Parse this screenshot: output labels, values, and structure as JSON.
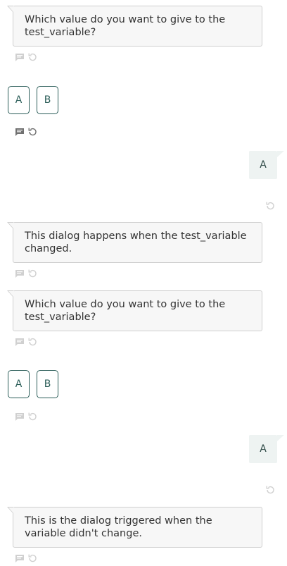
{
  "messages": {
    "q1": "Which value do you want to give to the test_variable?",
    "m2": "This dialog happens when the test_variable changed.",
    "q2": "Which value do you want to give to the test_variable?",
    "m3": "This is the dialog triggered when the variable didn't change."
  },
  "choices_1": [
    "A",
    "B"
  ],
  "choices_2": [
    "A",
    "B"
  ],
  "user_replies": [
    "A",
    "A"
  ],
  "icons": {
    "comment": "comment-icon",
    "replay": "replay-icon"
  },
  "colors": {
    "accent": "#2c5e59",
    "icon_light": "#cfcfcf",
    "icon_dark": "#6e6e6e"
  }
}
